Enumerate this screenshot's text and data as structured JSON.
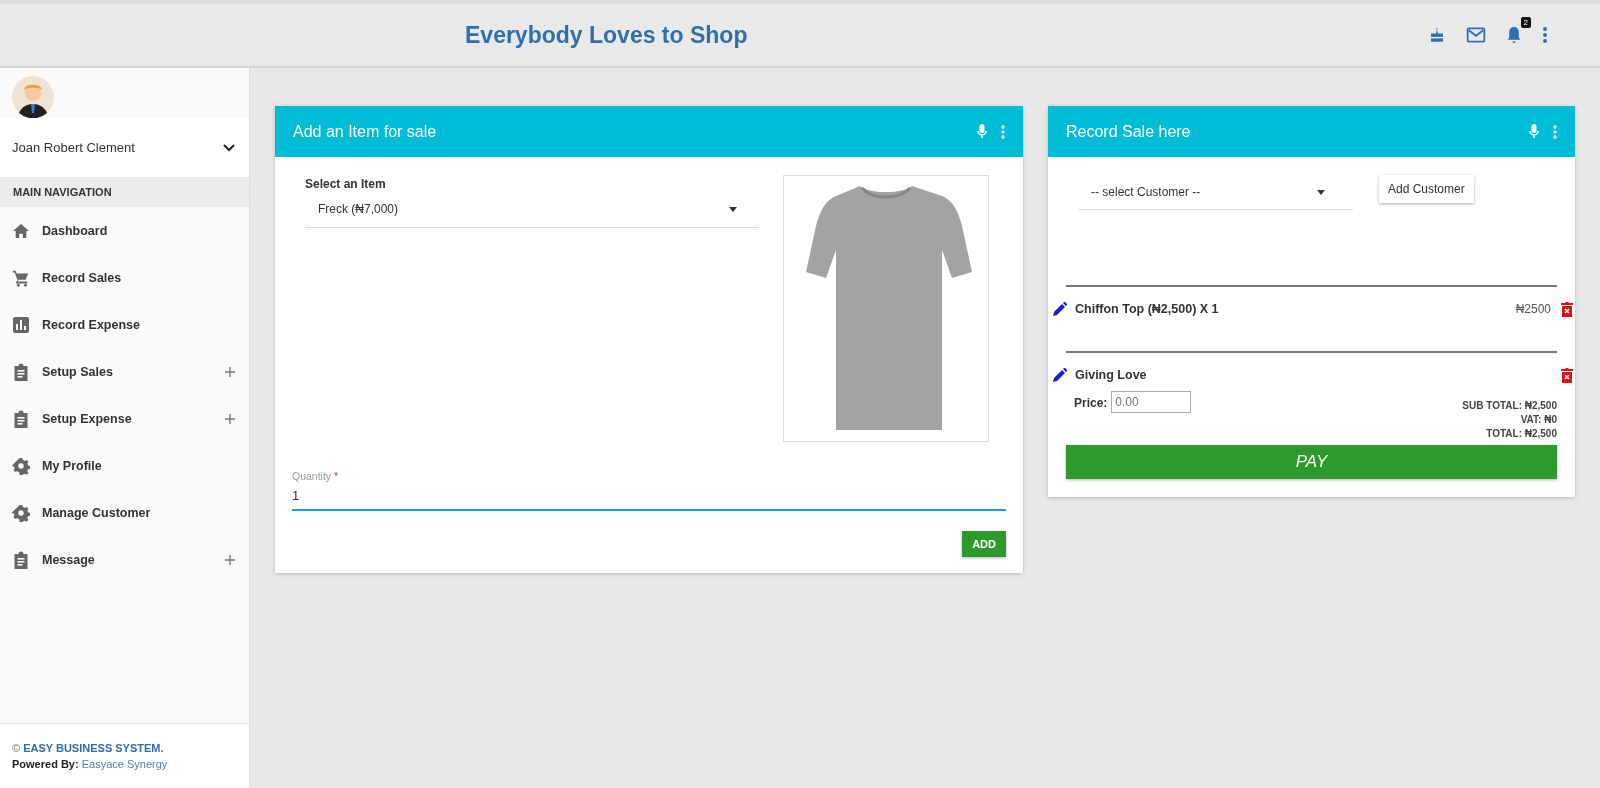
{
  "header": {
    "title": "Everybody Loves to Shop",
    "notification_count": "2"
  },
  "sidebar": {
    "user_name": "Joan Robert Clement",
    "section_title": "MAIN NAVIGATION",
    "items": [
      {
        "label": "Dashboard",
        "kind": "home",
        "expandable": false
      },
      {
        "label": "Record Sales",
        "kind": "cart",
        "expandable": false
      },
      {
        "label": "Record Expense",
        "kind": "chart",
        "expandable": false
      },
      {
        "label": "Setup Sales",
        "kind": "form",
        "expandable": true
      },
      {
        "label": "Setup Expense",
        "kind": "form",
        "expandable": true
      },
      {
        "label": "My Profile",
        "kind": "gear",
        "expandable": false
      },
      {
        "label": "Manage Customer",
        "kind": "gear",
        "expandable": false
      },
      {
        "label": "Message",
        "kind": "form",
        "expandable": true
      }
    ],
    "footer": {
      "copyright_mark": "©",
      "company": "EASY BUSINESS SYSTEM.",
      "powered_label": "Powered By:",
      "powered_by": "Easyace Synergy"
    }
  },
  "add_item_card": {
    "title": "Add an Item for sale",
    "select_label": "Select an Item",
    "select_value": "Freck (₦7,000)",
    "quantity_label": "Quantity",
    "required_mark": "*",
    "quantity_value": "1",
    "add_button": "ADD"
  },
  "record_sale_card": {
    "title": "Record Sale here",
    "customer_select": "-- select Customer --",
    "add_customer_button": "Add Customer",
    "lines": [
      {
        "kind": "product",
        "name": "Chiffon Top (₦2,500) X 1",
        "amount": "₦2500"
      },
      {
        "kind": "custom",
        "name": "Giving Love",
        "price_label": "Price:",
        "price_placeholder": "0.00"
      }
    ],
    "totals": [
      "SUB TOTAL: ₦2,500",
      "VAT: ₦0",
      "TOTAL: ₦2,500"
    ],
    "pay_button": "PAY"
  }
}
